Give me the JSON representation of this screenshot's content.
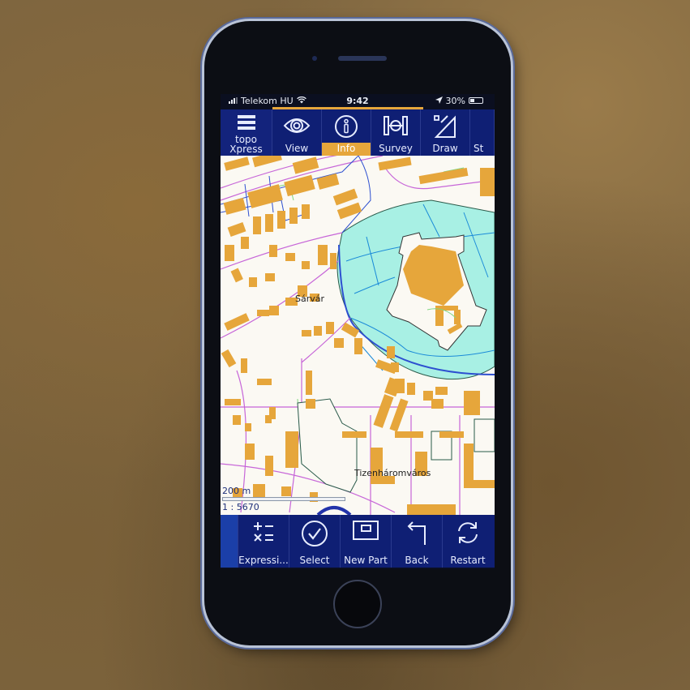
{
  "statusbar": {
    "carrier": "Telekom HU",
    "time": "9:42",
    "battery": "30%",
    "icons": [
      "signal-icon",
      "wifi-icon",
      "location-arrow-icon",
      "battery-icon"
    ]
  },
  "progress": {
    "value_percent": 55,
    "color": "#e6a63b"
  },
  "toolbar": {
    "logo_line1": "topo",
    "logo_line2": "Xpress",
    "items": [
      {
        "label": "View",
        "icon": "eye-icon",
        "active": false
      },
      {
        "label": "Info",
        "icon": "info-icon",
        "active": true
      },
      {
        "label": "Survey",
        "icon": "survey-icon",
        "active": false
      },
      {
        "label": "Draw",
        "icon": "draw-icon",
        "active": false
      },
      {
        "label": "St",
        "icon": "",
        "active": false
      }
    ]
  },
  "map": {
    "places": [
      "Sárvár",
      "Tizenháromváros"
    ],
    "scale_label": "200 m",
    "ratio_label": "1 : 5670",
    "colors": {
      "background": "#fbf9f3",
      "building": "#e6a63b",
      "water": "#a8f0e4",
      "road_primary": "#c766d8",
      "road_secondary": "#2d4fd0",
      "path": "#7fd67f",
      "waterway": "#1a8ad8"
    }
  },
  "bottombar": {
    "items": [
      {
        "label": "Expressi...",
        "icon": "expression-icon"
      },
      {
        "label": "Select",
        "icon": "check-circle-icon"
      },
      {
        "label": "New Part",
        "icon": "new-part-icon"
      },
      {
        "label": "Back",
        "icon": "back-arrow-icon"
      },
      {
        "label": "Restart",
        "icon": "restart-icon"
      }
    ]
  },
  "theme": {
    "toolbar_bg": "#0f1f74",
    "accent": "#e6a63b"
  }
}
